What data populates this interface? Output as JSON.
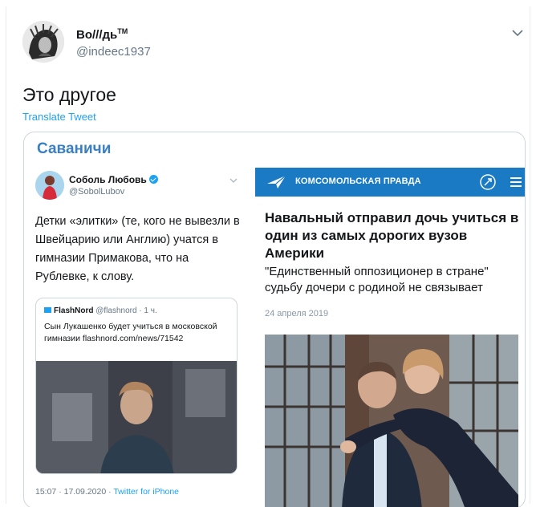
{
  "tweet": {
    "display_name": "Во///дь",
    "trademark": "TM",
    "handle": "@indeec1937",
    "text": "Это другое",
    "translate_label": "Translate Tweet"
  },
  "card": {
    "header": "Саваничи",
    "left_tweet": {
      "name": "Соболь Любовь",
      "handle": "@SobolLubov",
      "text": "Детки «элитки» (те, кого не вывезли в Швейцарию или Англию) учатся в гимназии Примакова, что на Рублевке, к слову.",
      "quote": {
        "source_name": "FlashNord",
        "source_handle": "@flashnord",
        "time": "· 1 ч.",
        "text": "Сын Лукашенко будет учиться в московской гимназии flashnord.com/news/71542"
      },
      "timestamp": "15:07 · 17.09.2020 · ",
      "client": "Twitter for iPhone"
    },
    "article": {
      "outlet": "КОМСОМОЛЬСКАЯ ПРАВДА",
      "title": "Навальный отправил дочь учиться в один из самых дорогих вузов Америки",
      "subtitle": "\"Единственный оппозиционер в стране\" судьбу дочери с родиной не связывает",
      "date": "24 апреля 2019"
    }
  },
  "colors": {
    "accent": "#1da1f2",
    "header_blue": "#3a7fc1",
    "kp_blue": "#1a7ac4"
  },
  "icons": {
    "menu": "chevron-down-icon",
    "verified": "verified-badge-icon",
    "kp_logo": "plane-logo-icon",
    "kp_rocket": "rocket-icon",
    "kp_menu": "hamburger-icon"
  }
}
